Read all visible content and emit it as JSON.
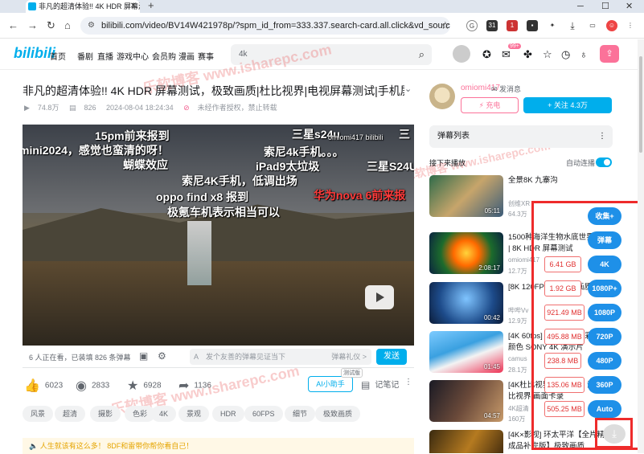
{
  "browser": {
    "tab_title": "非凡的超清体验!! 4K HDR 屏幕测",
    "url": "bilibili.com/video/BV14W421978p/?spm_id_from=333.337.search-card.all.click&vd_source=b...",
    "ext_badge_1": "31",
    "ext_badge_2": "1"
  },
  "header": {
    "logo": "bilibili",
    "nav": [
      "首页",
      "番剧",
      "直播",
      "游戏中心",
      "会员购",
      "漫画",
      "赛事"
    ],
    "search_value": "4k",
    "msg_badge": "99+"
  },
  "video": {
    "title": "非凡的超清体验!! 4K HDR 屏幕测试，极致画质|杜比视界|电视屏幕测试|手机屏...",
    "views": "74.8万",
    "danmaku_count": "826",
    "date": "2024-08-04 18:24:34",
    "notice": "未经作者授权，禁止转载",
    "danmaku": [
      "15pm前来报到",
      "三星s24u",
      "mini2024，感觉也蛮清的呀！",
      "索尼4k手机。。。",
      "蝴蝶效应",
      "iPad9太垃圾",
      "三星S24U",
      "索尼4K手机，低调出场",
      "oppo find x8 报到",
      "华为nova 6前来报",
      "极氪车机表示相当可以",
      "三",
      "omiomi417 bilibili"
    ],
    "watching": "6 人正在看，已装填 826 条弹幕",
    "dm_placeholder": "发个友善的弹幕见证当下",
    "dm_etiquette": "弹幕礼仪 >",
    "send": "发送",
    "likes": "6023",
    "coins": "2833",
    "favs": "6928",
    "shares": "1136",
    "ai_btn": "AI小助手",
    "ai_tag": "测试版",
    "notes": "记笔记",
    "tags": [
      "风景",
      "超清",
      "摄影",
      "色彩",
      "4K",
      "景观",
      "HDR",
      "60FPS",
      "细节",
      "极致画质"
    ],
    "announcement": "人生就该有这么多！ 8DF和雷带你帮你看自己！"
  },
  "sidebar": {
    "up_name": "omiomi417",
    "send_msg": "发消息",
    "charge": "充电",
    "follow": "+ 关注 4.3万",
    "danmaku_list": "弹幕列表",
    "next_up": "接下来播放",
    "autoplay": "自动连播",
    "recs": [
      {
        "title": "全景8K 九寨沟",
        "author": "创维XR",
        "stats": "64.3万",
        "dur": "05:11"
      },
      {
        "title": "1500种海洋生物水底世界呈现 | 8K HDR 屏幕测试",
        "author": "omiomi417",
        "stats": "12.7万",
        "dur": "2:08:17"
      },
      {
        "title": "[8K 120FPS] 阿凡达画质",
        "author": "哔哔Vv",
        "stats": "12.9万",
        "dur": "00:42"
      },
      {
        "title": "[4K 60fps] 索尼 极致色彩器的颜色 SONY 4K 演示片",
        "author": "camus",
        "stats": "28.1万",
        "dur": "01:45"
      },
      {
        "title": "[4K杜比视界] 杜比视界 演示 杜比视界 画面卡录",
        "author": "4K超清",
        "stats": "160万",
        "dur": "04:57"
      },
      {
        "title": "[4K×影视] 环太平洋【全片精华成品补完版】极致画质",
        "author": "",
        "stats": "",
        "dur": ""
      }
    ]
  },
  "downloader": {
    "sizes": [
      "6.41 GB",
      "1.92 GB",
      "921.49 MB",
      "495.88 MB",
      "238.8 MB",
      "135.06 MB",
      "505.25 MB"
    ],
    "buttons": [
      "收集+",
      "弹幕",
      "4K",
      "1080P+",
      "1080P",
      "720P",
      "480P",
      "360P",
      "Auto"
    ],
    "download_icon": "download-icon"
  },
  "watermark": "乐软博客 www.isharepc.com",
  "colors": {
    "brand": "#00aeec",
    "pink": "#fb7299",
    "highlight": "#ee2b2b",
    "quality_btn": "#1e90e8"
  }
}
